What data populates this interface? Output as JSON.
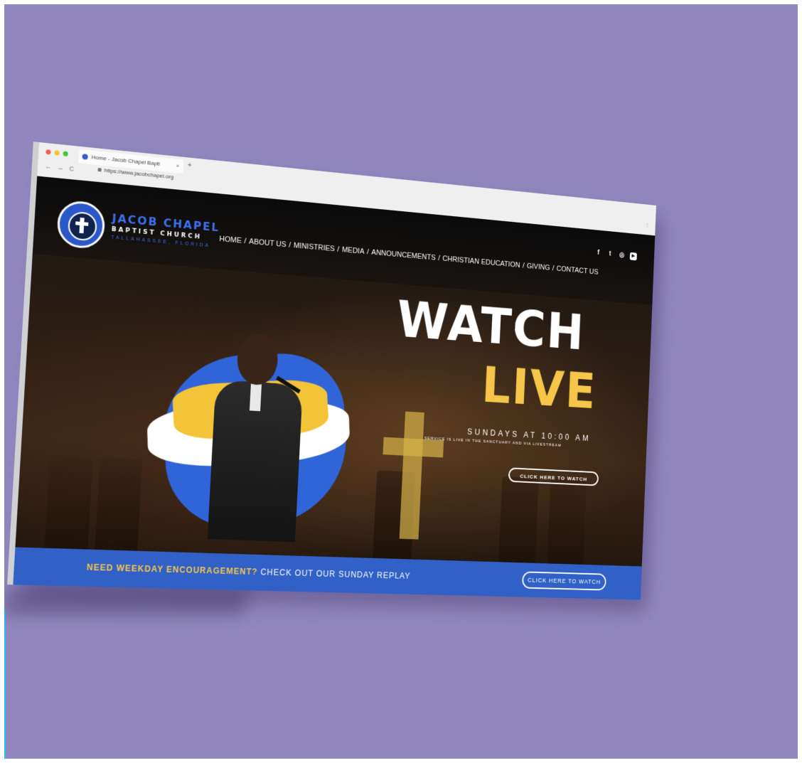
{
  "browser": {
    "tab_title": "Home - Jacob Chapel Bapti",
    "tab_close": "×",
    "new_tab": "+",
    "url": "https://www.jacobchapel.org",
    "nav_back": "←",
    "nav_forward": "→",
    "nav_reload": "C",
    "menu": "⋮"
  },
  "site": {
    "logo": {
      "line1": "JACOB CHAPEL",
      "line2": "BAPTIST CHURCH",
      "line3": "TALLAHASSEE, FLORIDA"
    },
    "nav": {
      "items": [
        "HOME",
        "ABOUT US",
        "MINISTRIES",
        "MEDIA",
        "ANNOUNCEMENTS",
        "CHRISTIAN EDUCATION",
        "GIVING",
        "CONTACT US"
      ],
      "separator": "/"
    },
    "social": {
      "facebook": "f",
      "twitter": "t",
      "instagram": "◎",
      "youtube": "▶"
    },
    "hero": {
      "watch": "WATCH",
      "live": "LIVE",
      "sundays": "SUNDAYS AT 10:00 AM",
      "subtitle": "SERVICE IS LIVE IN THE SANCTUARY AND VIA LIVESTREAM",
      "button": "CLICK HERE TO WATCH"
    },
    "banner": {
      "highlight": "NEED WEEKDAY ENCOURAGEMENT?",
      "rest": "CHECK OUT OUR SUNDAY REPLAY",
      "button": "CLICK HERE TO WATCH"
    },
    "colors": {
      "accent_blue": "#3160c6",
      "accent_yellow": "#f6c64a",
      "background": "#9288bf"
    }
  }
}
